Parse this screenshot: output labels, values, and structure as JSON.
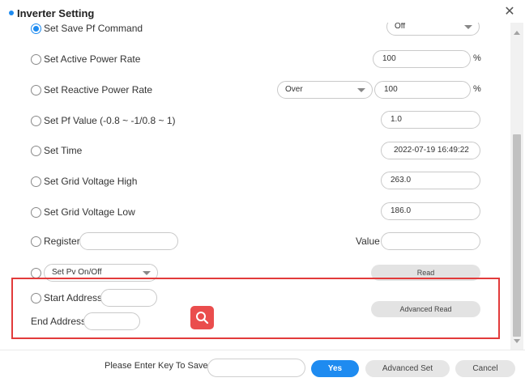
{
  "dialog": {
    "title": "Inverter Setting",
    "accent_color": "#1e8bf0",
    "close_icon": "close-icon"
  },
  "settings": {
    "save_pf": {
      "label": "Set Save Pf Command",
      "selected": true,
      "select_value": "Off"
    },
    "active_power": {
      "label": "Set Active Power Rate",
      "value": "100",
      "unit": "%"
    },
    "reactive_power": {
      "label": "Set Reactive Power Rate",
      "mode": "Over",
      "value": "100",
      "unit": "%"
    },
    "pf_value": {
      "label": "Set Pf Value (-0.8 ~ -1/0.8 ~ 1)",
      "value": "1.0"
    },
    "time": {
      "label": "Set Time",
      "value": "2022-07-19 16:49:22"
    },
    "grid_high": {
      "label": "Set Grid Voltage High",
      "value": "263.0"
    },
    "grid_low": {
      "label": "Set Grid Voltage Low",
      "value": "186.0"
    },
    "register": {
      "label": "Register",
      "value_label": "Value"
    },
    "pv": {
      "select_value": "Set Pv On/Off",
      "read_button": "Read"
    },
    "address": {
      "start_label": "Start Address",
      "end_label": "End Address",
      "advanced_read_button": "Advanced Read"
    }
  },
  "highlight_color": "#e23b3b",
  "footer": {
    "key_label": "Please Enter Key To Save",
    "yes_button": "Yes",
    "advanced_set_button": "Advanced Set",
    "cancel_button": "Cancel"
  }
}
